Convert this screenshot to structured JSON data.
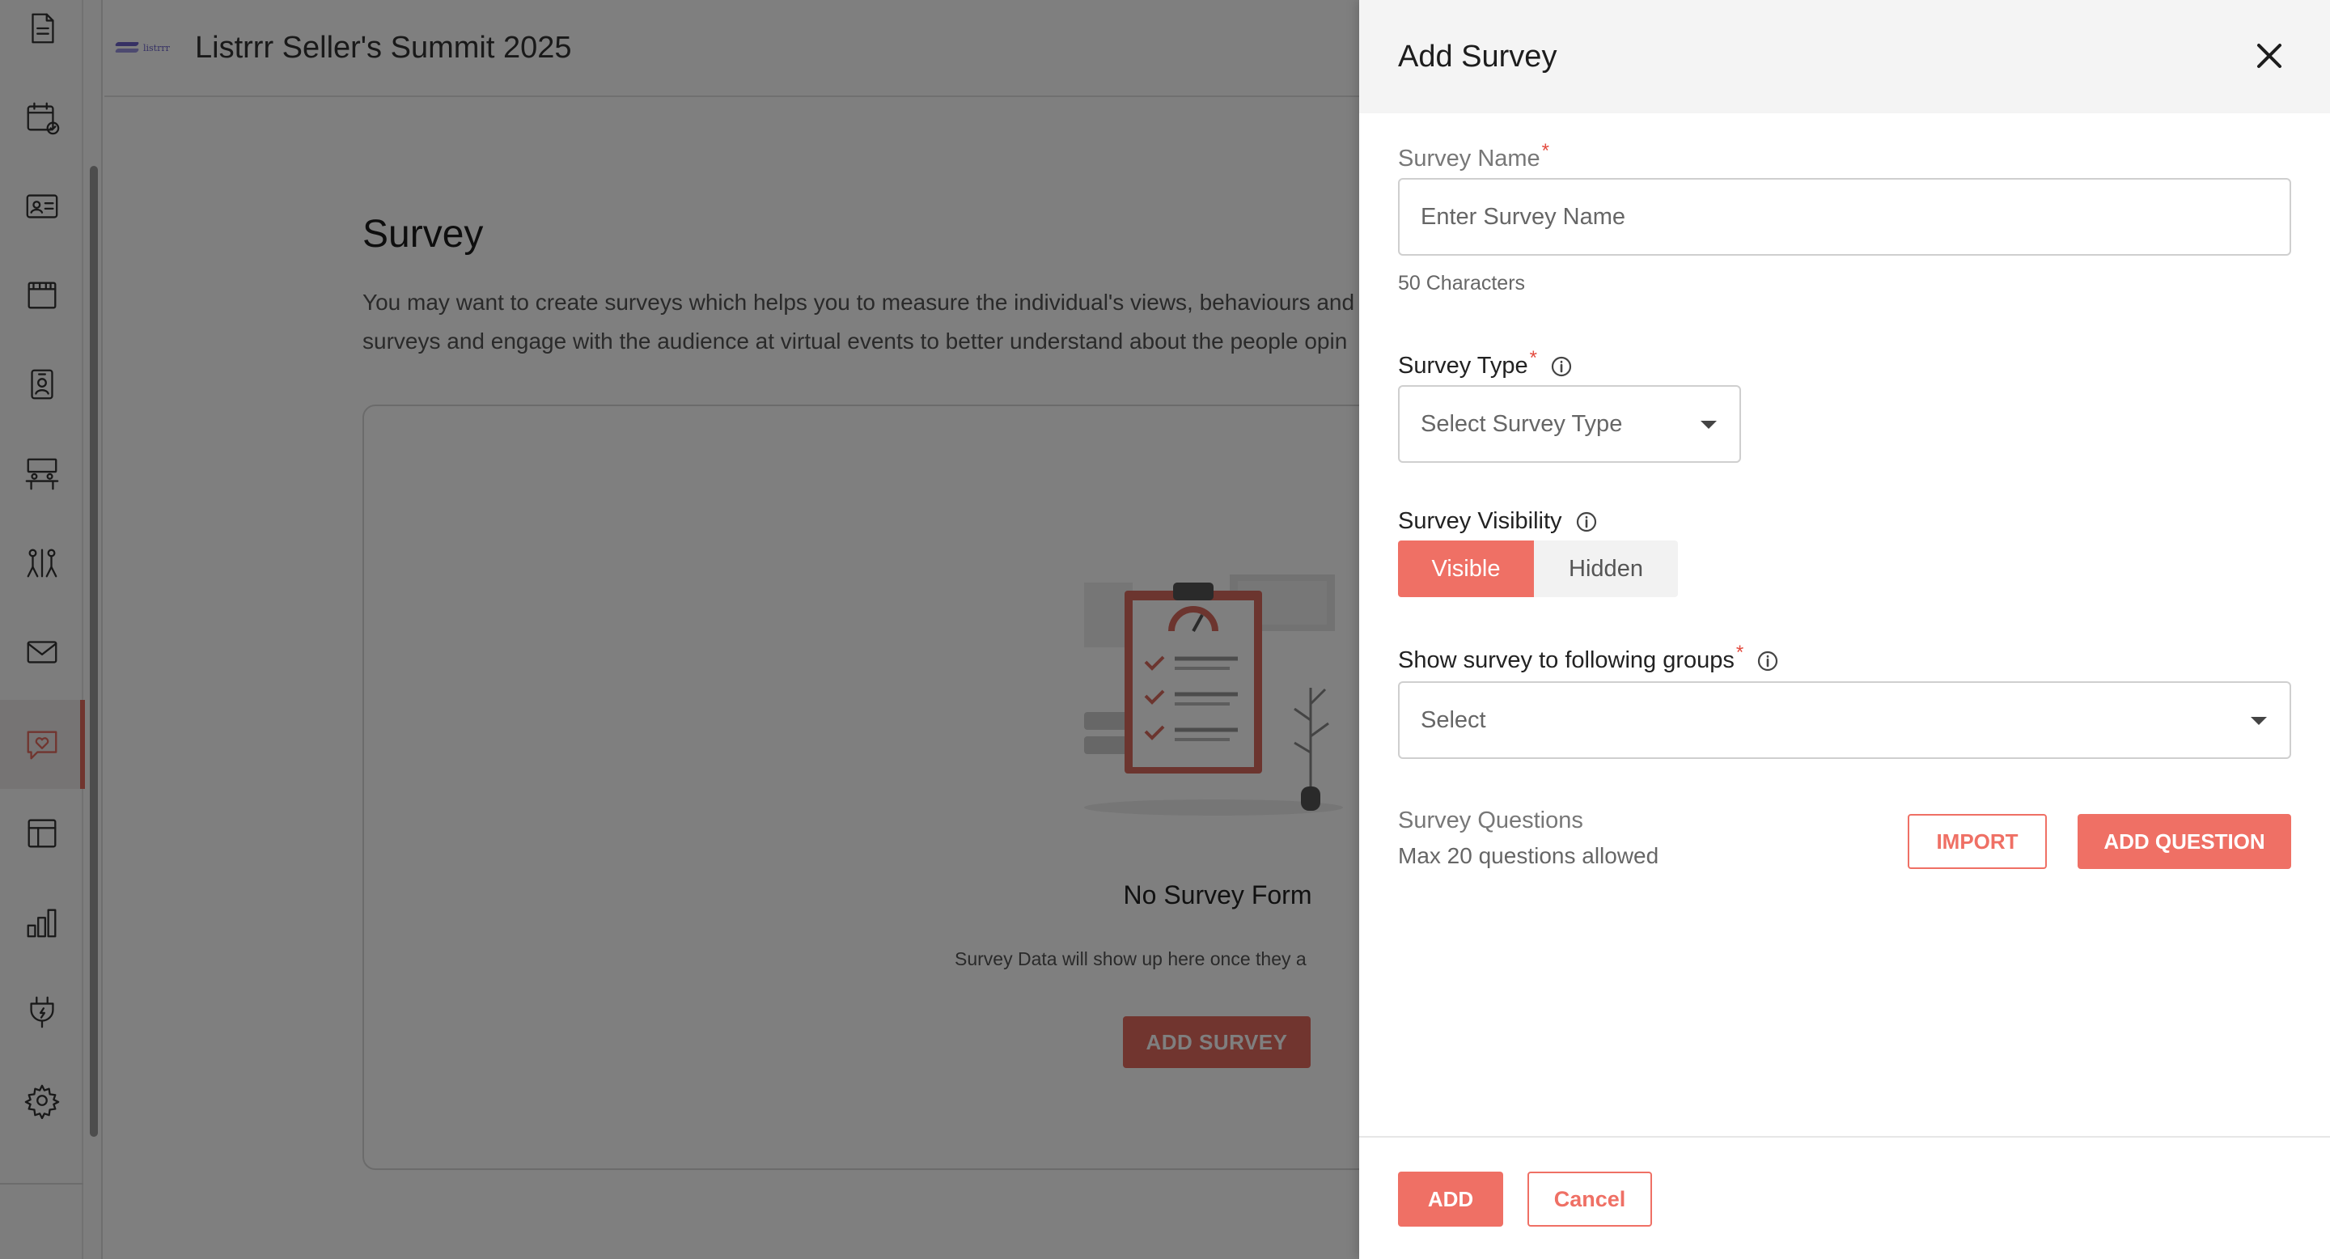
{
  "app": {
    "event_title": "Listrrr Seller's Summit 2025",
    "logo_text": "listrrr"
  },
  "sidebar": {
    "items": [
      {
        "icon": "document-icon"
      },
      {
        "icon": "calendar-check-icon"
      },
      {
        "icon": "id-card-icon"
      },
      {
        "icon": "storefront-icon"
      },
      {
        "icon": "badge-icon"
      },
      {
        "icon": "meeting-table-icon"
      },
      {
        "icon": "networking-icon"
      },
      {
        "icon": "mail-icon"
      },
      {
        "icon": "survey-chat-heart-icon",
        "active": true
      },
      {
        "icon": "layout-icon"
      },
      {
        "icon": "analytics-icon"
      },
      {
        "icon": "integrations-plug-icon"
      },
      {
        "icon": "settings-gear-icon"
      }
    ]
  },
  "page": {
    "title": "Survey",
    "description": "You may want to create surveys which helps you to measure the individual's views, behaviours and surveys and engage with the audience at virtual events to better understand about the people opin",
    "empty_title": "No Survey Form",
    "empty_subtitle": "Survey Data will show up here once they a",
    "add_survey_label": "ADD SURVEY"
  },
  "drawer": {
    "title": "Add Survey",
    "survey_name": {
      "label": "Survey Name",
      "required_mark": "*",
      "placeholder": "Enter Survey Name",
      "value": "",
      "hint": "50 Characters"
    },
    "survey_type": {
      "label": "Survey Type",
      "required_mark": "*",
      "placeholder": "Select Survey Type"
    },
    "survey_visibility": {
      "label": "Survey Visibility",
      "options": [
        "Visible",
        "Hidden"
      ],
      "selected": "Visible"
    },
    "groups": {
      "label": "Show survey to following groups",
      "required_mark": "*",
      "placeholder": "Select"
    },
    "questions": {
      "title": "Survey Questions",
      "subtitle": "Max 20 questions allowed",
      "import_label": "IMPORT",
      "add_question_label": "ADD QUESTION"
    },
    "footer": {
      "add_label": "ADD",
      "cancel_label": "Cancel"
    }
  },
  "colors": {
    "accent": "#ef7065",
    "accent_dark": "#e36a5f",
    "required": "#e34b3f",
    "overlay": "rgba(0,0,0,0.5)"
  }
}
